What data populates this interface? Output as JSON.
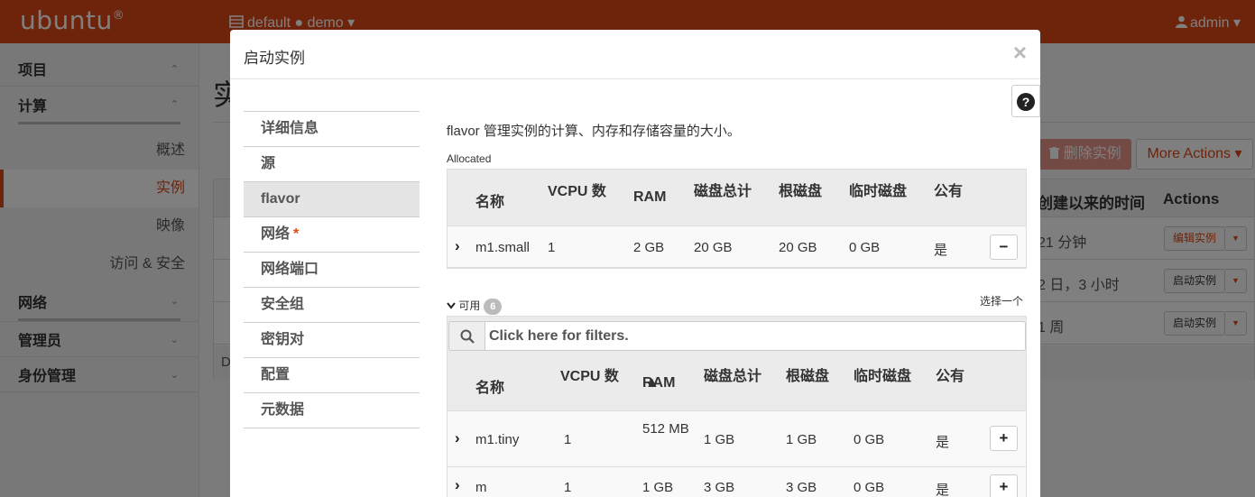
{
  "topbar": {
    "brand": "ubuntu",
    "brand_mark": "®",
    "project": "default ● demo ▾",
    "user": "admin ▾"
  },
  "sidebar": {
    "groups": [
      {
        "label": "项目",
        "chev": "⌃"
      },
      {
        "label": "计算",
        "chev": "⌃"
      },
      {
        "label": "网络",
        "chev": "⌄"
      },
      {
        "label": "管理员",
        "chev": "⌄"
      },
      {
        "label": "身份管理",
        "chev": "⌄"
      }
    ],
    "items": [
      "概述",
      "实例",
      "映像",
      "访问 & 安全"
    ]
  },
  "background": {
    "title": "实",
    "delete_btn": "删除实例",
    "more_actions": "More Actions ▾",
    "col_age": "创建以来的时间",
    "col_actions": "Actions",
    "rows": [
      {
        "age": "21 分钟",
        "action": "编辑实例"
      },
      {
        "age": "2 日，3 小时",
        "action": "启动实例"
      },
      {
        "age": "1 周",
        "action": "启动实例"
      }
    ],
    "footer": "D"
  },
  "modal": {
    "title": "启动实例",
    "close": "×",
    "help": "?",
    "nav": [
      "详细信息",
      "源",
      "flavor",
      "网络",
      "网络端口",
      "安全组",
      "密钥对",
      "配置",
      "元数据"
    ],
    "required_mark": "*",
    "description": "flavor 管理实例的计算、内存和存储容量的大小。",
    "allocated_label": "Allocated",
    "available_label": "可用",
    "available_count": "6",
    "select_one": "选择一个",
    "filter_placeholder": "Click here for filters.",
    "columns": {
      "name": "名称",
      "vcpu": "VCPU 数",
      "ram": "RAM",
      "disk_total": "磁盘总计",
      "root_disk": "根磁盘",
      "ephemeral": "临时磁盘",
      "public": "公有"
    },
    "allocated_rows": [
      {
        "name": "m1.small",
        "vcpu": "1",
        "ram": "2 GB",
        "disk_total": "20 GB",
        "root_disk": "20 GB",
        "ephemeral": "0 GB",
        "public": "是",
        "button": "−"
      }
    ],
    "available_rows": [
      {
        "name": "m1.tiny",
        "vcpu": "1",
        "ram": "512 MB",
        "disk_total": "1 GB",
        "root_disk": "1 GB",
        "ephemeral": "0 GB",
        "public": "是",
        "button": "+"
      },
      {
        "name": "m",
        "vcpu": "1",
        "ram": "1 GB",
        "disk_total": "3 GB",
        "root_disk": "3 GB",
        "ephemeral": "0 GB",
        "public": "是",
        "button": "+"
      }
    ]
  },
  "icons": {
    "expand": "chevron-right-icon",
    "collapse": "chevron-down-icon",
    "search": "search-icon",
    "trash": "trash-icon",
    "user": "user-icon",
    "server": "server-icon"
  }
}
